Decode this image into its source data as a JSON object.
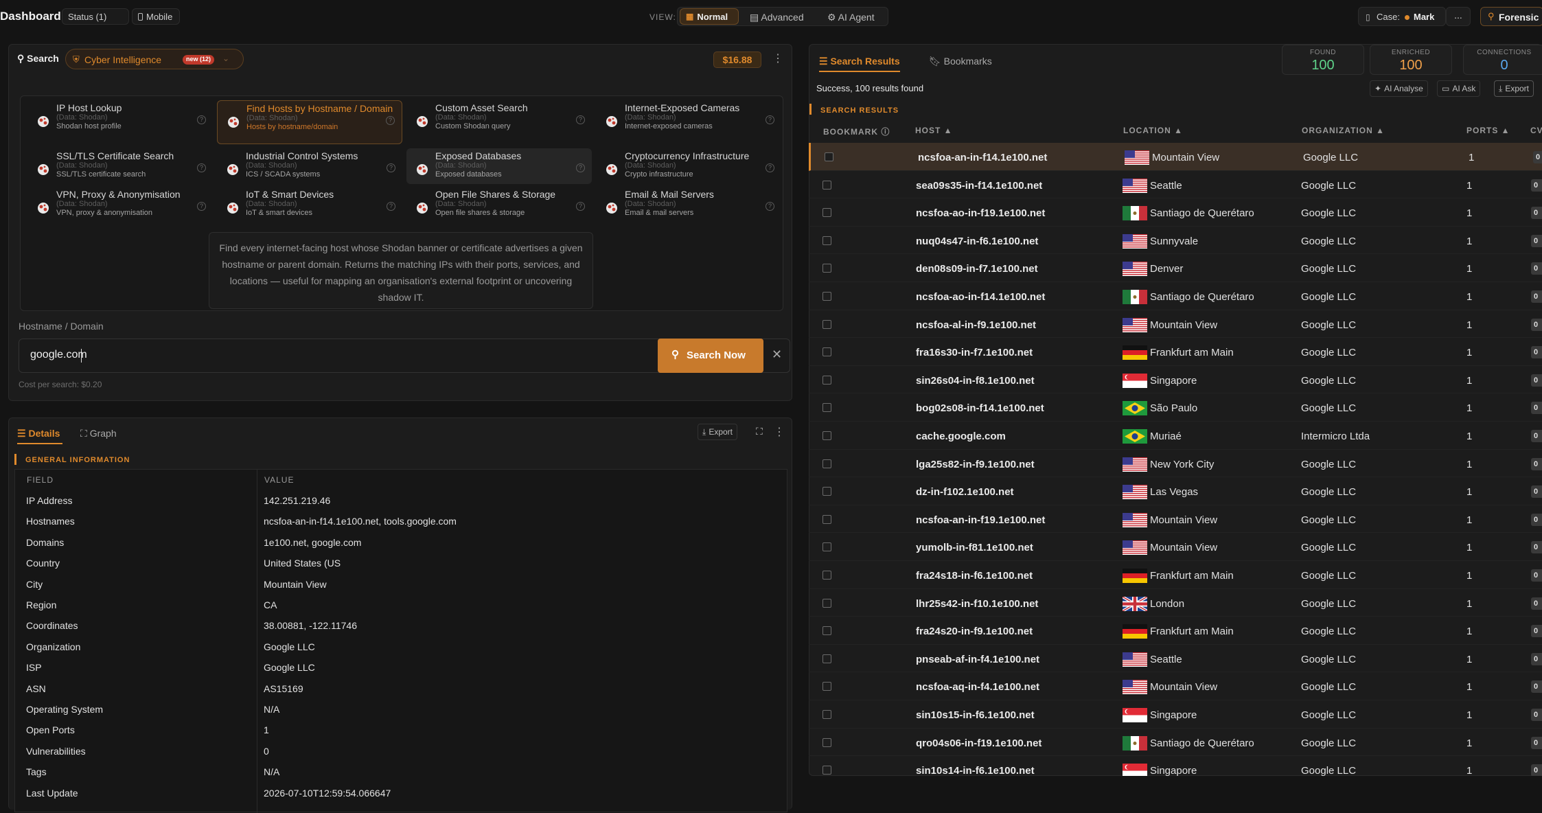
{
  "header": {
    "title": "Dashboard",
    "status_label": "Status (1)",
    "mobile_label": "Mobile",
    "view_label": "VIEW:",
    "view_options": [
      "Normal",
      "Advanced",
      "AI Agent"
    ],
    "case_label": "Case:",
    "case_name": "Mark",
    "more_label": "...",
    "forensic_label": "Forensic"
  },
  "search": {
    "title": "Search",
    "category": "Cyber Intelligence",
    "new_badge": "new (12)",
    "price": "$16.88",
    "tools": [
      {
        "title": "IP Host Lookup",
        "source": "(Data: Shodan)",
        "desc": "Shodan host profile"
      },
      {
        "title": "Find Hosts by Hostname / Domain",
        "source": "(Data: Shodan)",
        "desc": "Hosts by hostname/domain"
      },
      {
        "title": "Custom Asset Search",
        "source": "(Data: Shodan)",
        "desc": "Custom Shodan query"
      },
      {
        "title": "Internet-Exposed Cameras",
        "source": "(Data: Shodan)",
        "desc": "Internet-exposed cameras"
      },
      {
        "title": "SSL/TLS Certificate Search",
        "source": "(Data: Shodan)",
        "desc": "SSL/TLS certificate search"
      },
      {
        "title": "Industrial Control Systems",
        "source": "(Data: Shodan)",
        "desc": "ICS / SCADA systems"
      },
      {
        "title": "Exposed Databases",
        "source": "(Data: Shodan)",
        "desc": "Exposed databases"
      },
      {
        "title": "Cryptocurrency Infrastructure",
        "source": "(Data: Shodan)",
        "desc": "Crypto infrastructure"
      },
      {
        "title": "VPN, Proxy & Anonymisation",
        "source": "(Data: Shodan)",
        "desc": "VPN, proxy & anonymisation"
      },
      {
        "title": "IoT & Smart Devices",
        "source": "(Data: Shodan)",
        "desc": "IoT & smart devices"
      },
      {
        "title": "Open File Shares & Storage",
        "source": "(Data: Shodan)",
        "desc": "Open file shares & storage"
      },
      {
        "title": "Email & Mail Servers",
        "source": "(Data: Shodan)",
        "desc": "Email & mail servers"
      }
    ],
    "description": "Find every internet-facing host whose Shodan banner or certificate advertises a given hostname or parent domain. Returns the matching IPs with their ports, services, and locations — useful for mapping an organisation's external footprint or uncovering shadow IT.",
    "field_label": "Hostname / Domain",
    "input_value": "google.com",
    "button_label": "Search Now",
    "cost_note": "Cost per search: $0.20"
  },
  "details": {
    "tab_details": "Details",
    "tab_graph": "Graph",
    "export_label": "Export",
    "section_title": "GENERAL INFORMATION",
    "col_field": "FIELD",
    "col_value": "VALUE",
    "rows": [
      {
        "field": "IP Address",
        "value": "142.251.219.46"
      },
      {
        "field": "Hostnames",
        "value": "ncsfoa-an-in-f14.1e100.net, tools.google.com"
      },
      {
        "field": "Domains",
        "value": "1e100.net, google.com"
      },
      {
        "field": "Country",
        "value": "United States (US"
      },
      {
        "field": "City",
        "value": "Mountain View"
      },
      {
        "field": "Region",
        "value": "CA"
      },
      {
        "field": "Coordinates",
        "value": "38.00881, -122.11746"
      },
      {
        "field": "Organization",
        "value": "Google LLC"
      },
      {
        "field": "ISP",
        "value": "Google LLC"
      },
      {
        "field": "ASN",
        "value": "AS15169"
      },
      {
        "field": "Operating System",
        "value": "N/A"
      },
      {
        "field": "Open Ports",
        "value": "1"
      },
      {
        "field": "Vulnerabilities",
        "value": "0"
      },
      {
        "field": "Tags",
        "value": "N/A"
      },
      {
        "field": "Last Update",
        "value": "2026-07-10T12:59:54.066647"
      }
    ]
  },
  "results": {
    "tab_results": "Search Results",
    "tab_bookmarks": "Bookmarks",
    "found_label": "FOUND",
    "found_value": "100",
    "enriched_label": "ENRICHED",
    "enriched_value": "100",
    "connections_label": "CONNECTIONS",
    "connections_value": "0",
    "status_text": "Success, 100 results found",
    "ai_analyse": "AI Analyse",
    "ai_ask": "AI Ask",
    "export_label": "Export",
    "section_title": "SEARCH RESULTS",
    "columns": [
      "BOOKMARK",
      "HOST ▲",
      "LOCATION ▲",
      "ORGANIZATION ▲",
      "PORTS ▲",
      "CV"
    ],
    "rows": [
      {
        "host": "ncsfoa-an-in-f14.1e100.net",
        "flag": "us",
        "location": "Mountain View",
        "org": "Google LLC",
        "ports": "1",
        "cv": "0"
      },
      {
        "host": "sea09s35-in-f14.1e100.net",
        "flag": "us",
        "location": "Seattle",
        "org": "Google LLC",
        "ports": "1",
        "cv": "0"
      },
      {
        "host": "ncsfoa-ao-in-f19.1e100.net",
        "flag": "mx",
        "location": "Santiago de Querétaro",
        "org": "Google LLC",
        "ports": "1",
        "cv": "0"
      },
      {
        "host": "nuq04s47-in-f6.1e100.net",
        "flag": "us",
        "location": "Sunnyvale",
        "org": "Google LLC",
        "ports": "1",
        "cv": "0"
      },
      {
        "host": "den08s09-in-f7.1e100.net",
        "flag": "us",
        "location": "Denver",
        "org": "Google LLC",
        "ports": "1",
        "cv": "0"
      },
      {
        "host": "ncsfoa-ao-in-f14.1e100.net",
        "flag": "mx",
        "location": "Santiago de Querétaro",
        "org": "Google LLC",
        "ports": "1",
        "cv": "0"
      },
      {
        "host": "ncsfoa-al-in-f9.1e100.net",
        "flag": "us",
        "location": "Mountain View",
        "org": "Google LLC",
        "ports": "1",
        "cv": "0"
      },
      {
        "host": "fra16s30-in-f7.1e100.net",
        "flag": "de",
        "location": "Frankfurt am Main",
        "org": "Google LLC",
        "ports": "1",
        "cv": "0"
      },
      {
        "host": "sin26s04-in-f8.1e100.net",
        "flag": "sg",
        "location": "Singapore",
        "org": "Google LLC",
        "ports": "1",
        "cv": "0"
      },
      {
        "host": "bog02s08-in-f14.1e100.net",
        "flag": "br",
        "location": "São Paulo",
        "org": "Google LLC",
        "ports": "1",
        "cv": "0"
      },
      {
        "host": "cache.google.com",
        "flag": "br",
        "location": "Muriaé",
        "org": "Intermicro Ltda",
        "ports": "1",
        "cv": "0"
      },
      {
        "host": "lga25s82-in-f9.1e100.net",
        "flag": "us",
        "location": "New York City",
        "org": "Google LLC",
        "ports": "1",
        "cv": "0"
      },
      {
        "host": "dz-in-f102.1e100.net",
        "flag": "us",
        "location": "Las Vegas",
        "org": "Google LLC",
        "ports": "1",
        "cv": "0"
      },
      {
        "host": "ncsfoa-an-in-f19.1e100.net",
        "flag": "us",
        "location": "Mountain View",
        "org": "Google LLC",
        "ports": "1",
        "cv": "0"
      },
      {
        "host": "yumolb-in-f81.1e100.net",
        "flag": "us",
        "location": "Mountain View",
        "org": "Google LLC",
        "ports": "1",
        "cv": "0"
      },
      {
        "host": "fra24s18-in-f6.1e100.net",
        "flag": "de",
        "location": "Frankfurt am Main",
        "org": "Google LLC",
        "ports": "1",
        "cv": "0"
      },
      {
        "host": "lhr25s42-in-f10.1e100.net",
        "flag": "gb",
        "location": "London",
        "org": "Google LLC",
        "ports": "1",
        "cv": "0"
      },
      {
        "host": "fra24s20-in-f9.1e100.net",
        "flag": "de",
        "location": "Frankfurt am Main",
        "org": "Google LLC",
        "ports": "1",
        "cv": "0"
      },
      {
        "host": "pnseab-af-in-f4.1e100.net",
        "flag": "us",
        "location": "Seattle",
        "org": "Google LLC",
        "ports": "1",
        "cv": "0"
      },
      {
        "host": "ncsfoa-aq-in-f4.1e100.net",
        "flag": "us",
        "location": "Mountain View",
        "org": "Google LLC",
        "ports": "1",
        "cv": "0"
      },
      {
        "host": "sin10s15-in-f6.1e100.net",
        "flag": "sg",
        "location": "Singapore",
        "org": "Google LLC",
        "ports": "1",
        "cv": "0"
      },
      {
        "host": "qro04s06-in-f19.1e100.net",
        "flag": "mx",
        "location": "Santiago de Querétaro",
        "org": "Google LLC",
        "ports": "1",
        "cv": "0"
      },
      {
        "host": "sin10s14-in-f6.1e100.net",
        "flag": "sg",
        "location": "Singapore",
        "org": "Google LLC",
        "ports": "1",
        "cv": "0"
      }
    ]
  },
  "colors": {
    "accent": "#e08a2c",
    "background": "#141414",
    "panel": "#1c1c1c",
    "selected_row": "#3a2f26"
  }
}
